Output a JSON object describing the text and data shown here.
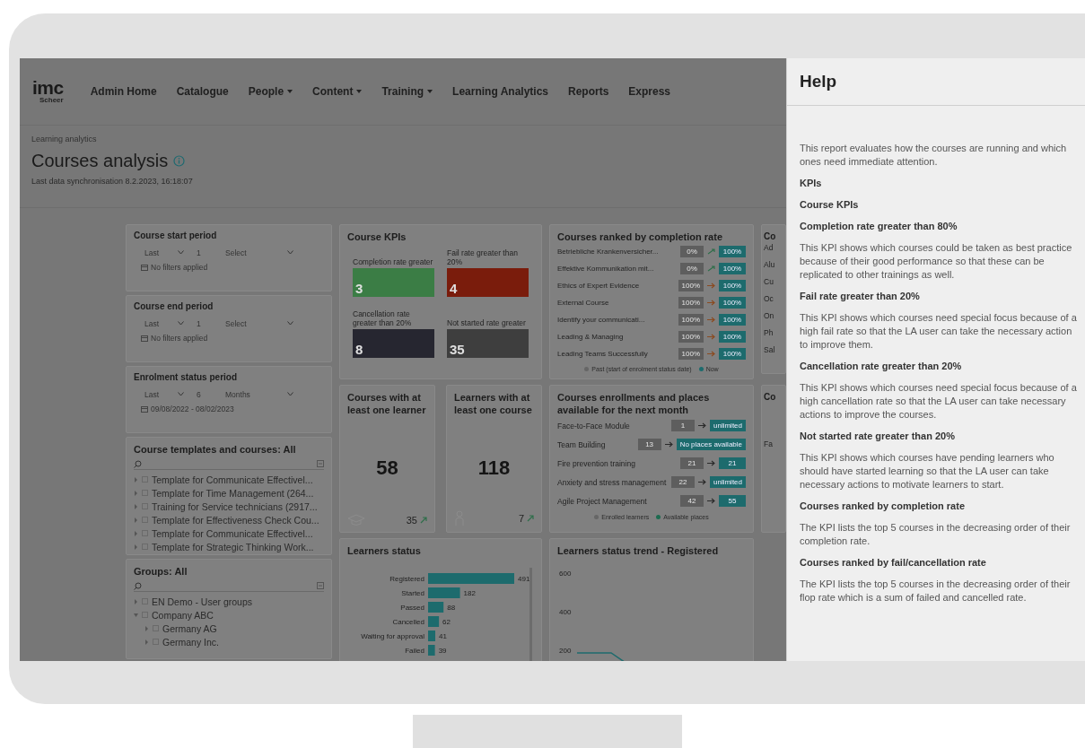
{
  "logo": {
    "text": "imc",
    "subtitle": "Scheer"
  },
  "nav": [
    {
      "label": "Admin Home",
      "dropdown": false
    },
    {
      "label": "Catalogue",
      "dropdown": false
    },
    {
      "label": "People",
      "dropdown": true
    },
    {
      "label": "Content",
      "dropdown": true
    },
    {
      "label": "Training",
      "dropdown": true
    },
    {
      "label": "Learning Analytics",
      "dropdown": false
    },
    {
      "label": "Reports",
      "dropdown": false
    },
    {
      "label": "Express",
      "dropdown": false
    }
  ],
  "breadcrumb": "Learning analytics",
  "title": "Courses analysis",
  "sync": "Last data synchronisation 8.2.2023, 16:18:07",
  "periods": [
    {
      "title": "Course start period",
      "mode": "Last",
      "count": "1",
      "unit": "Select",
      "note": "No filters applied"
    },
    {
      "title": "Course end period",
      "mode": "Last",
      "count": "1",
      "unit": "Select",
      "note": "No filters applied"
    },
    {
      "title": "Enrolment status period",
      "mode": "Last",
      "count": "6",
      "unit": "Months",
      "note": "09/08/2022 - 08/02/2023"
    }
  ],
  "templates": {
    "title": "Course templates and courses: All",
    "items": [
      {
        "label": "Template for Communicate Effectivel...",
        "checked": false,
        "expanded": false
      },
      {
        "label": "Template for Time Management (264...",
        "checked": false,
        "expanded": false
      },
      {
        "label": "Training for Service technicians (2917...",
        "checked": false,
        "expanded": false
      },
      {
        "label": "Template for Effectiveness Check Cou...",
        "checked": false,
        "expanded": false
      },
      {
        "label": "Template for Communicate Effectivel...",
        "checked": false,
        "expanded": false
      },
      {
        "label": "Template for Strategic Thinking Work...",
        "checked": false,
        "expanded": false
      }
    ]
  },
  "groups": {
    "title": "Groups: All",
    "items": [
      {
        "label": "EN Demo - User groups",
        "checked": false,
        "expanded": false
      },
      {
        "label": "Company ABC",
        "checked": false,
        "expanded": true,
        "children": [
          {
            "label": "Germany AG",
            "checked": false,
            "expanded": false
          },
          {
            "label": "Germany Inc.",
            "checked": false,
            "expanded": false
          }
        ]
      }
    ]
  },
  "course_kpis": {
    "title": "Course KPIs",
    "tiles": [
      {
        "label": "Completion rate greater",
        "value": "3",
        "color": "#3b7d45"
      },
      {
        "label": "Fail rate greater than 20%",
        "value": "4",
        "color": "#7a1c0c"
      },
      {
        "label": "Cancellation rate greater than 20%",
        "value": "8",
        "color": "#262630"
      },
      {
        "label": "Not started rate greater",
        "value": "35",
        "color": "#3e3e3e"
      }
    ]
  },
  "counters": [
    {
      "title": "Courses with at least one learner",
      "value": "58",
      "delta": "35",
      "kind": "courses"
    },
    {
      "title": "Learners with at least one course",
      "value": "118",
      "delta": "7",
      "kind": "learners"
    }
  ],
  "learners_status": {
    "title": "Learners status",
    "chart_data": {
      "type": "bar",
      "orientation": "horizontal",
      "categories": [
        "Registered",
        "Started",
        "Passed",
        "Cancelled",
        "Waiting for approval",
        "Failed"
      ],
      "values": [
        491,
        182,
        88,
        62,
        41,
        39
      ],
      "data_labels": true
    }
  },
  "ranked": {
    "title": "Courses ranked by completion rate",
    "rows": [
      {
        "name": "Betriebliche Krankenversicher...",
        "past": "0%",
        "now": "100%",
        "kind": "up"
      },
      {
        "name": "Effektive Kommunikation mit...",
        "past": "0%",
        "now": "100%",
        "kind": "up"
      },
      {
        "name": "Ethics of Expert Evidence",
        "past": "100%",
        "now": "100%",
        "kind": "flat"
      },
      {
        "name": "External Course",
        "past": "100%",
        "now": "100%",
        "kind": "flat"
      },
      {
        "name": "Identify your communicati...",
        "past": "100%",
        "now": "100%",
        "kind": "flat"
      },
      {
        "name": "Leading & Managing",
        "past": "100%",
        "now": "100%",
        "kind": "flat"
      },
      {
        "name": "Leading Teams Successfully",
        "past": "100%",
        "now": "100%",
        "kind": "flat"
      }
    ],
    "legend": [
      "Past (start of enrolment status date)",
      "Now"
    ]
  },
  "enrollments": {
    "title": "Courses enrollments and places available for the next month",
    "rows": [
      {
        "name": "Face-to-Face Module",
        "enrolled": "1",
        "available": "unlimited"
      },
      {
        "name": "Team Building",
        "enrolled": "13",
        "available": "No places available"
      },
      {
        "name": "Fire prevention training",
        "enrolled": "21",
        "available": "21"
      },
      {
        "name": "Anxiety and stress management",
        "enrolled": "22",
        "available": "unlimited"
      },
      {
        "name": "Agile Project Management",
        "enrolled": "42",
        "available": "55"
      }
    ],
    "legend": [
      "Enrolled learners",
      "Available places"
    ]
  },
  "trend": {
    "title": "Learners status trend - Registered",
    "axis_labels": [
      "600",
      "400",
      "200"
    ]
  },
  "column_4": [
    {
      "title": "Co",
      "items": [
        "Ad",
        "Alu",
        "Cu",
        "Oc",
        "On",
        "Ph",
        "Sal"
      ]
    },
    {
      "title": "Co",
      "items": [
        "Fa"
      ]
    }
  ],
  "help": {
    "title": "Help",
    "blocks": [
      {
        "kind": "text",
        "text": "This report evaluates how the courses are running and which ones need immediate attention."
      },
      {
        "kind": "heading",
        "text": "KPIs"
      },
      {
        "kind": "heading",
        "text": "Course KPIs"
      },
      {
        "kind": "heading",
        "text": "Completion rate greater than 80%"
      },
      {
        "kind": "text",
        "text": "This KPI shows which courses could be taken as best practice because of their good performance so that these can be replicated to other trainings as well."
      },
      {
        "kind": "heading",
        "text": "Fail rate greater than 20%"
      },
      {
        "kind": "text",
        "text": "This KPI shows which courses need special focus because of a high fail rate so that the LA user can take the necessary action to improve them."
      },
      {
        "kind": "heading",
        "text": "Cancellation rate greater than 20%"
      },
      {
        "kind": "text",
        "text": "This KPI shows which courses need special focus because of a high cancellation rate so that the LA user can take necessary actions to improve the courses."
      },
      {
        "kind": "heading",
        "text": "Not started rate greater than 20%"
      },
      {
        "kind": "text",
        "text": "This KPI shows which courses have pending learners who should have started learning so that the LA user can take necessary actions to motivate learners to start."
      },
      {
        "kind": "heading",
        "text": "Courses ranked by completion rate"
      },
      {
        "kind": "text",
        "text": "The KPI lists the top 5 courses in the decreasing order of their completion rate."
      },
      {
        "kind": "heading",
        "text": "Courses ranked by fail/cancellation rate"
      },
      {
        "kind": "text",
        "text": "The KPI lists the top 5 courses in the decreasing order of their flop rate which is a sum of failed and cancelled rate."
      }
    ]
  }
}
